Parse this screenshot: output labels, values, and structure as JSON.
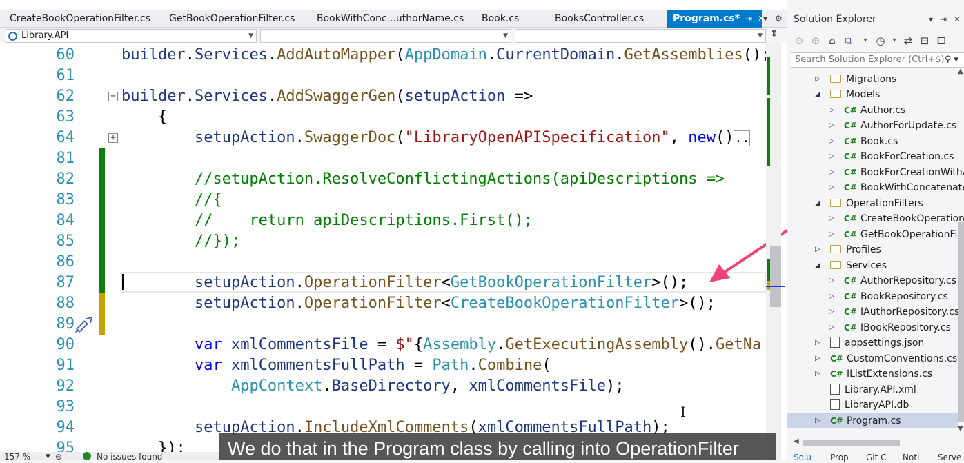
{
  "tabs": [
    {
      "label": "CreateBookOperationFilter.cs"
    },
    {
      "label": "GetBookOperationFilter.cs"
    },
    {
      "label": "BookWithConc...uthorName.cs"
    },
    {
      "label": "Book.cs"
    },
    {
      "label": "BooksController.cs"
    },
    {
      "label": "Program.cs*"
    }
  ],
  "navbar": {
    "project": "Library.API",
    "member": "",
    "scope": ""
  },
  "code": {
    "l60": {
      "n": "60"
    },
    "l61": {
      "n": "61"
    },
    "l62": {
      "n": "62"
    },
    "l63": {
      "n": "63"
    },
    "l64": {
      "n": "64"
    },
    "l81": {
      "n": "81"
    },
    "l82": {
      "n": "82"
    },
    "l83": {
      "n": "83"
    },
    "l84": {
      "n": "84"
    },
    "l85": {
      "n": "85"
    },
    "l86": {
      "n": "86"
    },
    "l87": {
      "n": "87"
    },
    "l88": {
      "n": "88"
    },
    "l89": {
      "n": "89"
    },
    "l90": {
      "n": "90"
    },
    "l91": {
      "n": "91"
    },
    "l92": {
      "n": "92"
    },
    "l93": {
      "n": "93"
    },
    "l94": {
      "n": "94"
    },
    "l95": {
      "n": "95"
    }
  },
  "status": {
    "zoom": "157 %",
    "issues": "No issues found"
  },
  "caption": "We do that in the Program class by calling into OperationFilter",
  "solution_explorer": {
    "title": "Solution Explorer",
    "search_placeholder": "Search Solution Explorer (Ctrl+$)",
    "items": [
      {
        "label": "Migrations",
        "kind": "folder"
      },
      {
        "label": "Models",
        "kind": "folder"
      },
      {
        "label": "Author.cs",
        "kind": "cs"
      },
      {
        "label": "AuthorForUpdate.cs",
        "kind": "cs"
      },
      {
        "label": "Book.cs",
        "kind": "cs"
      },
      {
        "label": "BookForCreation.cs",
        "kind": "cs"
      },
      {
        "label": "BookForCreationWithAı",
        "kind": "cs"
      },
      {
        "label": "BookWithConcatenatec",
        "kind": "cs"
      },
      {
        "label": "OperationFilters",
        "kind": "folder"
      },
      {
        "label": "CreateBookOperationFi",
        "kind": "cs"
      },
      {
        "label": "GetBookOperationFilter",
        "kind": "cs"
      },
      {
        "label": "Profiles",
        "kind": "folder"
      },
      {
        "label": "Services",
        "kind": "folder"
      },
      {
        "label": "AuthorRepository.cs",
        "kind": "cs"
      },
      {
        "label": "BookRepository.cs",
        "kind": "cs"
      },
      {
        "label": "IAuthorRepository.cs",
        "kind": "cs"
      },
      {
        "label": "IBookRepository.cs",
        "kind": "cs"
      },
      {
        "label": "appsettings.json",
        "kind": "file"
      },
      {
        "label": "CustomConventions.cs",
        "kind": "cs"
      },
      {
        "label": "IListExtensions.cs",
        "kind": "cs"
      },
      {
        "label": "Library.API.xml",
        "kind": "file"
      },
      {
        "label": "LibraryAPI.db",
        "kind": "file"
      },
      {
        "label": "Program.cs",
        "kind": "cs"
      }
    ],
    "bottom_tabs": [
      "Solu",
      "Prop",
      "Git C",
      "Noti",
      "Serve"
    ]
  },
  "colors": {
    "accent": "#007acc",
    "arrow": "#f0437a"
  }
}
